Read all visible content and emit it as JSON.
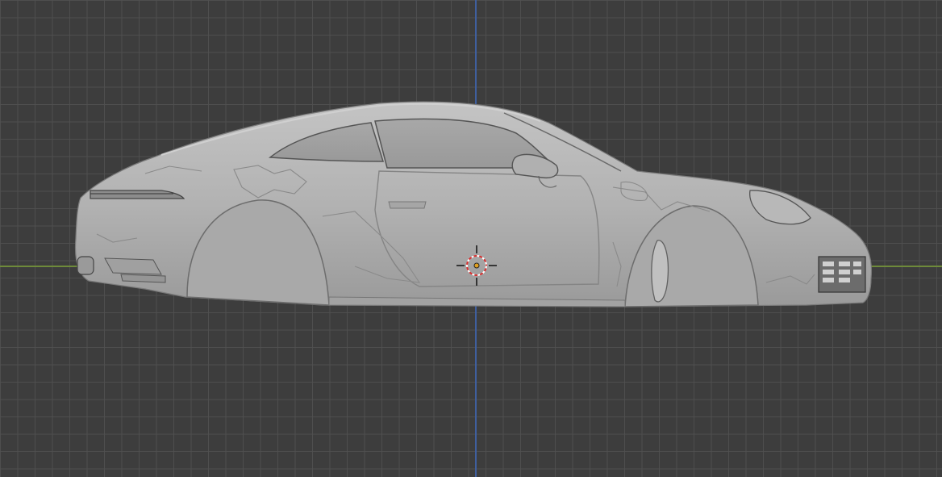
{
  "viewport": {
    "view": "side-orthographic",
    "colors": {
      "background": "#3d3d3d",
      "grid": "#505050",
      "x_axis": "#6e8a3a",
      "z_axis": "#3f5f9e",
      "model_surface": "#b4b4b4"
    }
  },
  "scene": {
    "object_type": "car-body-mesh",
    "cursor_icon": "3d-cursor-icon"
  }
}
